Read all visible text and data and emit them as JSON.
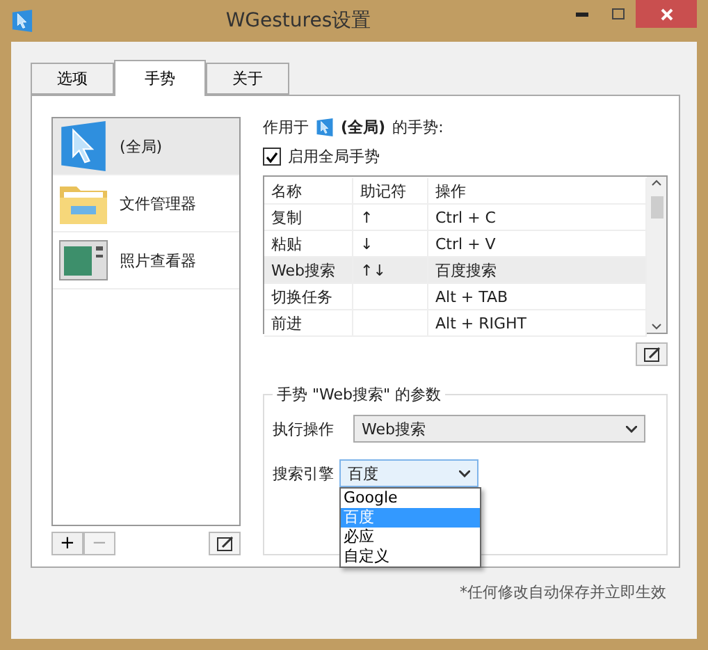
{
  "window": {
    "title": "WGestures设置"
  },
  "tabs": [
    {
      "label": "选项",
      "selected": false
    },
    {
      "label": "手势",
      "selected": true
    },
    {
      "label": "关于",
      "selected": false
    }
  ],
  "apps": [
    {
      "name": "(全局)",
      "kind": "global",
      "selected": true
    },
    {
      "name": "文件管理器",
      "kind": "folder",
      "selected": false
    },
    {
      "name": "照片查看器",
      "kind": "photos",
      "selected": false
    }
  ],
  "app_buttons": {
    "add": "+",
    "remove": "−"
  },
  "scope": {
    "prefix": "作用于",
    "app": "(全局)",
    "suffix": "的手势:"
  },
  "enable_global": {
    "label": "启用全局手势",
    "checked": true
  },
  "table": {
    "columns": [
      "名称",
      "助记符",
      "操作"
    ],
    "rows": [
      {
        "name": "复制",
        "mnemonic": "↑",
        "action": "Ctrl + C",
        "selected": false
      },
      {
        "name": "粘贴",
        "mnemonic": "↓",
        "action": "Ctrl + V",
        "selected": false
      },
      {
        "name": "Web搜索",
        "mnemonic": "↑↓",
        "action": "百度搜索",
        "selected": true
      },
      {
        "name": "切换任务",
        "action": "Alt + TAB",
        "selected": false
      },
      {
        "name": "前进",
        "action": "Alt + RIGHT",
        "selected": false
      }
    ]
  },
  "params": {
    "title": "手势 \"Web搜索\" 的参数",
    "action_label": "执行操作",
    "action_value": "Web搜索",
    "engine_label": "搜索引擎",
    "engine_value": "百度",
    "engine_options": [
      {
        "label": "Google",
        "selected": false
      },
      {
        "label": "百度",
        "selected": true
      },
      {
        "label": "必应",
        "selected": false
      },
      {
        "label": "自定义",
        "selected": false
      }
    ]
  },
  "footer": "*任何修改自动保存并立即生效"
}
